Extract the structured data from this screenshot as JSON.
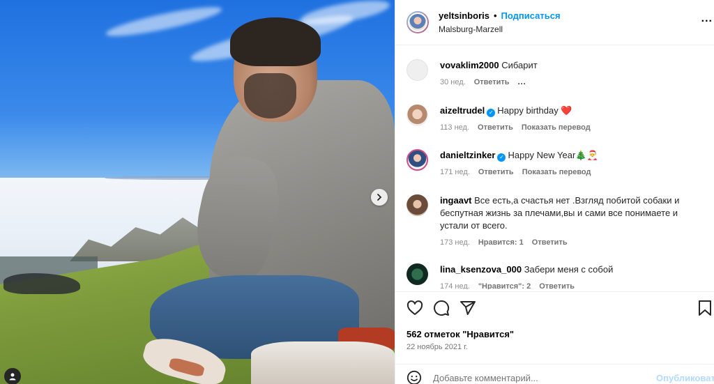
{
  "post": {
    "author": "yeltsinboris",
    "separator": "•",
    "follow_label": "Подписаться",
    "location": "Malsburg-Marzell",
    "more_label": "..."
  },
  "comments": [
    {
      "user": "vovaklim2000",
      "text": "Сибарит",
      "verified": false,
      "time": "30 нед.",
      "reply_label": "Ответить",
      "more": "...",
      "avatar_color": "#efefef"
    },
    {
      "user": "aizeltrudel",
      "text": "Happy birthday ❤️",
      "verified": true,
      "time": "113 нед.",
      "reply_label": "Ответить",
      "translate_label": "Показать перевод",
      "avatar_color": "#c9a48c"
    },
    {
      "user": "danieltzinker",
      "text": "Happy New Year🎄🎅",
      "verified": true,
      "time": "171 нед.",
      "reply_label": "Ответить",
      "translate_label": "Показать перевод",
      "avatar_color": "#3a5d93"
    },
    {
      "user": "ingaavt",
      "text": "Все есть,а счастья нет .Взгляд побитой собаки и беспутная жизнь за плечами,вы и сами все понимаете и устали от всего.",
      "verified": false,
      "time": "173 нед.",
      "likes_label": "Нравится: 1",
      "reply_label": "Ответить",
      "avatar_color": "#7a5a48"
    },
    {
      "user": "lina_ksenzova_000",
      "text": "Забери меня с собой",
      "verified": false,
      "time": "174 нед.",
      "likes_label": "\"Нравится\": 2",
      "reply_label": "Ответить",
      "avatar_color": "#1e4d3a"
    }
  ],
  "footer": {
    "likes": "562 отметок \"Нравится\"",
    "date": "22 ноябрь 2021 г.",
    "comment_placeholder": "Добавьте комментарий...",
    "publish_label": "Опубликовать"
  },
  "icons": {
    "like": "heart-icon",
    "comment": "comment-icon",
    "share": "share-icon",
    "save": "bookmark-icon",
    "emoji": "emoji-icon",
    "next": "chevron-right-icon",
    "tag": "user-tag-icon"
  },
  "colors": {
    "accent": "#0095f6",
    "publish_disabled": "#b3dbff",
    "muted": "#737373"
  }
}
